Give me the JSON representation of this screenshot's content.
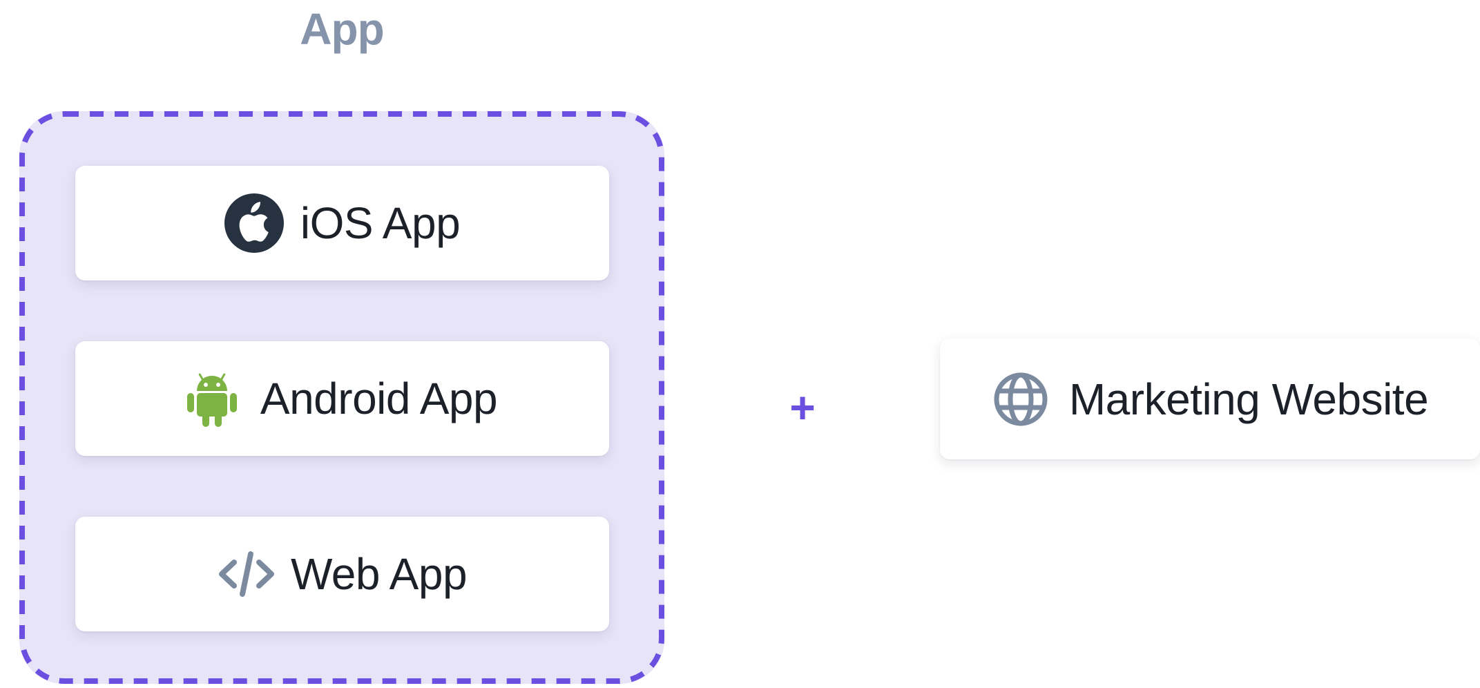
{
  "group": {
    "title": "App",
    "border_color": "#6b4fe0",
    "fill_color": "#e7e4f8"
  },
  "app_items": [
    {
      "label": "iOS App",
      "icon": "apple-icon"
    },
    {
      "label": "Android App",
      "icon": "android-icon",
      "icon_color": "#7cb342"
    },
    {
      "label": "Web App",
      "icon": "code-icon",
      "icon_color": "#7c8aa0"
    }
  ],
  "connector": {
    "symbol": "+",
    "color": "#6b4fe0"
  },
  "website": {
    "label": "Marketing Website",
    "icon": "globe-icon",
    "icon_color": "#7c8aa0"
  }
}
